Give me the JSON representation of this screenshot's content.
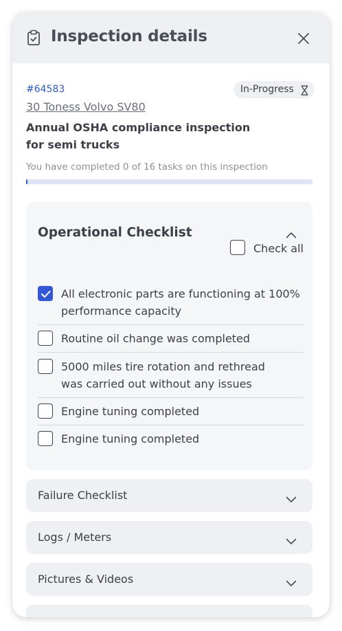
{
  "header": {
    "title": "Inspection details",
    "icon": "clipboard-check-icon",
    "close_icon": "close-icon"
  },
  "inspection": {
    "id": "#64583",
    "status": "In-Progress",
    "status_icon": "hourglass-icon",
    "vehicle": "30 Toness Volvo SV80",
    "title": "Annual OSHA compliance inspection for semi trucks",
    "progress_text": "You have completed 0 of 16 tasks on this inspection",
    "progress_fraction": 0
  },
  "operational_checklist": {
    "title": "Operational Checklist",
    "expanded": true,
    "check_all_label": "Check all",
    "items": [
      {
        "label": "All electronic parts are functioning at 100% performance capacity",
        "checked": true
      },
      {
        "label": "Routine oil change was completed",
        "checked": false
      },
      {
        "label": "5000 miles tire rotation and rethread was carried out without any issues",
        "checked": false
      },
      {
        "label": "Engine tuning completed",
        "checked": false
      },
      {
        "label": "Engine tuning completed",
        "checked": false
      }
    ]
  },
  "sections": [
    {
      "label": "Failure Checklist",
      "expanded": false
    },
    {
      "label": "Logs / Meters",
      "expanded": false
    },
    {
      "label": "Pictures & Videos",
      "expanded": false
    }
  ],
  "colors": {
    "accent": "#3457d5",
    "link": "#2f5bbf",
    "header_bg": "#eef0f3",
    "card_bg": "#f5f6f8",
    "progress_track": "#dde4f6"
  }
}
